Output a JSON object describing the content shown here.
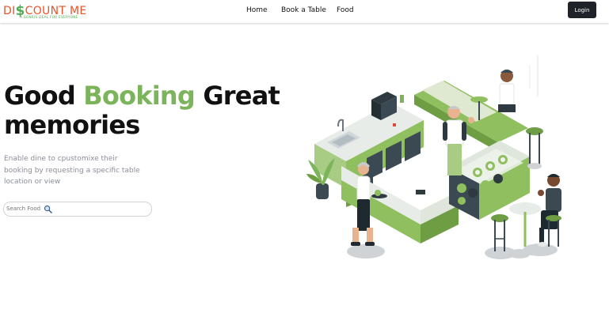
{
  "logo": {
    "text_prefix": "DI",
    "text_dollar": "$",
    "text_suffix": "COUNT ME",
    "tagline": "A GENIUS DEAL FOR EVERYONE"
  },
  "nav": {
    "home": "Home",
    "book": "Book a Table",
    "food": "Food",
    "login": "Login"
  },
  "hero": {
    "title_part1": "Good ",
    "title_accent": "Booking",
    "title_part2": " Great memories",
    "subtitle": "Enable dine to cpustomixe their booking by requesting a specific table location or view",
    "search_placeholder": "Search Food"
  },
  "colors": {
    "accent_green": "#7cb45b",
    "logo_orange": "#e8542a",
    "button_dark": "#1f2228"
  },
  "icons": {
    "search": "magnifier-icon",
    "illustration": "restaurant-counter-illustration"
  }
}
